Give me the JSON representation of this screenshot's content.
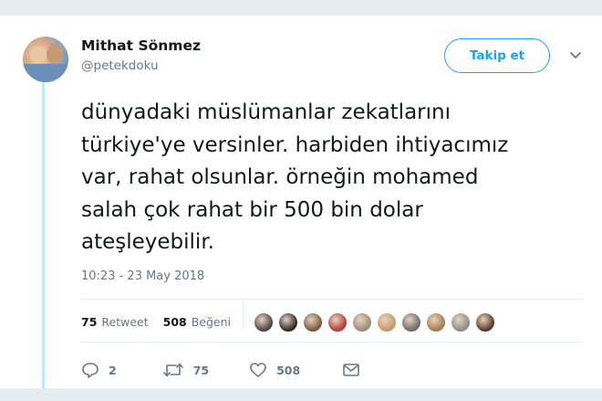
{
  "author": {
    "name": "Mithat Sönmez",
    "handle": "@petekdoku"
  },
  "follow_button": {
    "label": "Takip et"
  },
  "tweet": {
    "lines": [
      "dünyadaki müslümanlar zekatlarını",
      "türkiye'ye versinler. harbiden ihtiyacımız",
      "var, rahat olsunlar. örneğin mohamed",
      "salah çok rahat bir 500 bin dolar",
      "ateşleyebilir."
    ],
    "timestamp": "10:23 - 23 May 2018"
  },
  "stats": {
    "retweet_count": "75",
    "retweet_label": "Retweet",
    "like_count": "508",
    "like_label": "Beğeni"
  },
  "likers": [
    {
      "name": "liker-1-avatar",
      "color": "#4a4a4a"
    },
    {
      "name": "liker-2-avatar",
      "color": "#2b2b2b"
    },
    {
      "name": "liker-3-avatar",
      "color": "#7b5a45"
    },
    {
      "name": "liker-4-avatar",
      "color": "#b0413e"
    },
    {
      "name": "liker-5-avatar",
      "color": "#9c8c7a"
    },
    {
      "name": "liker-6-avatar",
      "color": "#c49a6c"
    },
    {
      "name": "liker-7-avatar",
      "color": "#6d6d6d"
    },
    {
      "name": "liker-8-avatar",
      "color": "#a67c52"
    },
    {
      "name": "liker-9-avatar",
      "color": "#8d8d8d"
    },
    {
      "name": "liker-10-avatar",
      "color": "#5a3c2e"
    }
  ],
  "actions": {
    "reply_count": "2",
    "retweet_count": "75",
    "like_count": "508"
  },
  "colors": {
    "accent": "#1da1f2",
    "thread_line": "#bfe9f8",
    "secondary_text": "#657786",
    "page_background": "#e6ecf0"
  }
}
